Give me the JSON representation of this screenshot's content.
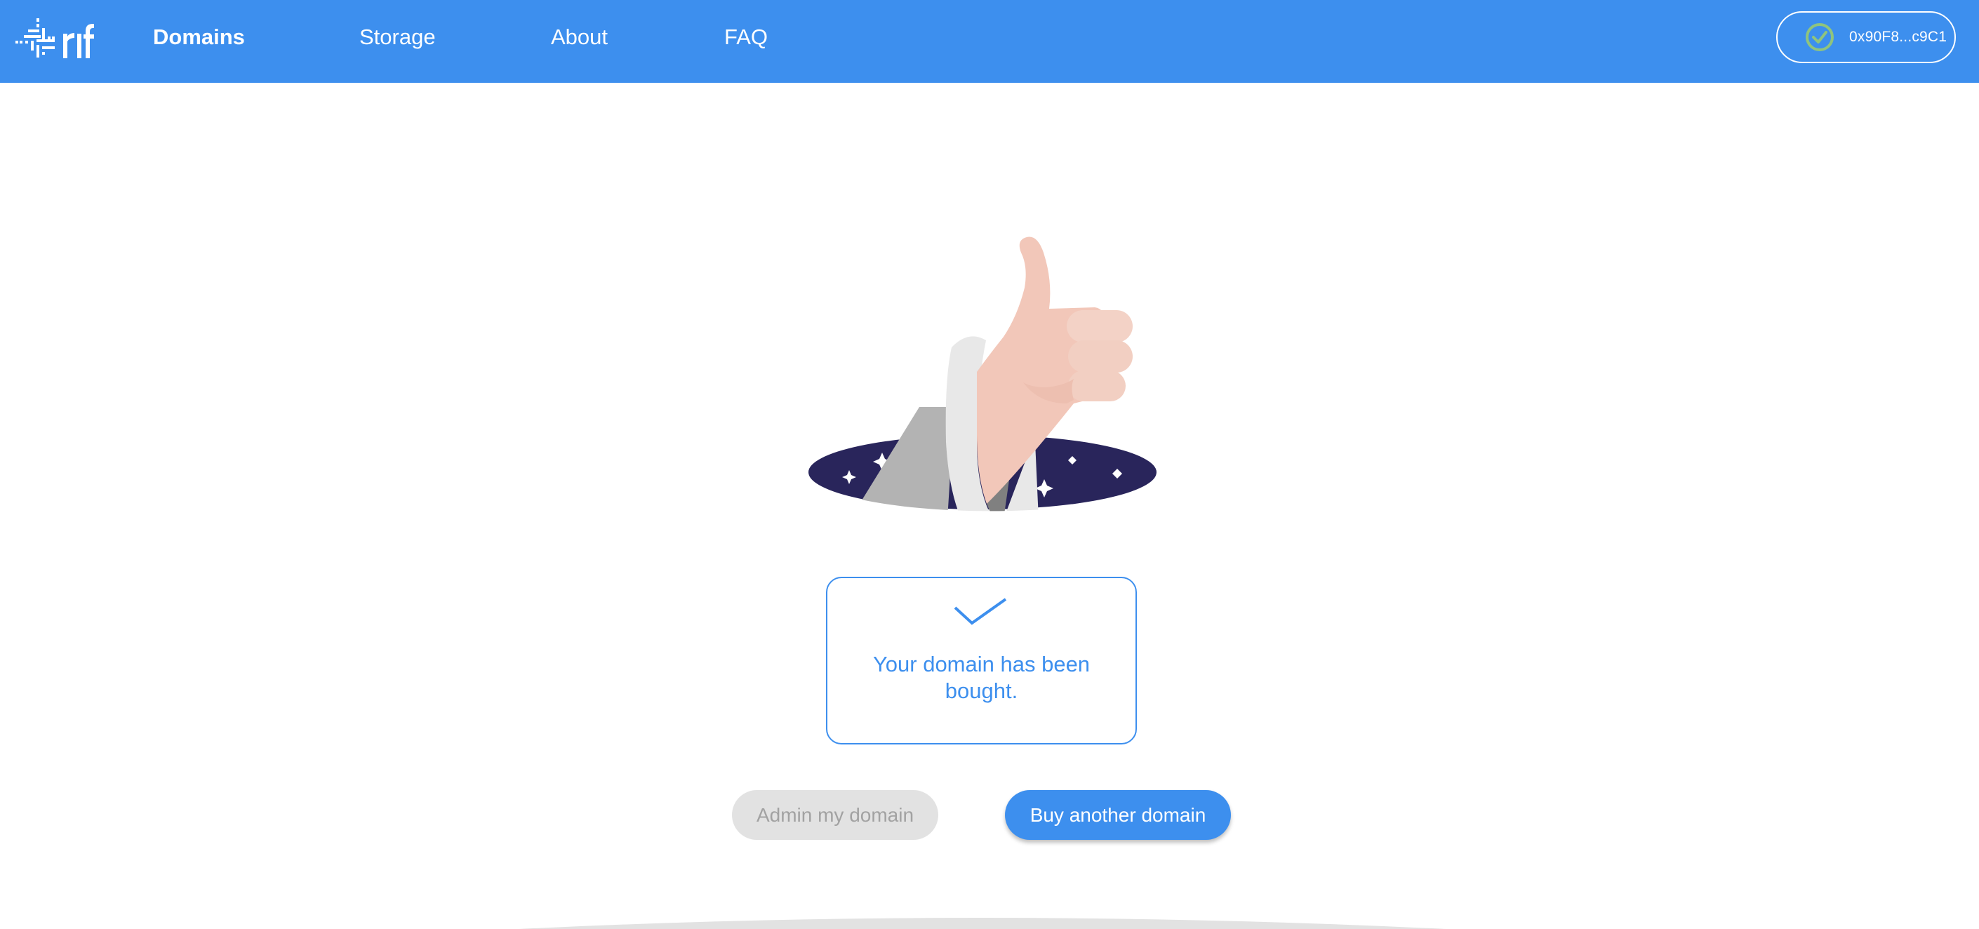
{
  "header": {
    "logo_text": "rif",
    "nav": [
      {
        "label": "Domains",
        "active": true
      },
      {
        "label": "Storage",
        "active": false
      },
      {
        "label": "About",
        "active": false
      },
      {
        "label": "FAQ",
        "active": false
      }
    ],
    "wallet": {
      "address": "0x90F8...c9C1",
      "status_icon": "check-circle-icon",
      "status_color": "#8fc47e"
    }
  },
  "main": {
    "illustration": "thumbs-up-hand-from-hole",
    "success_card": {
      "icon": "checkmark-icon",
      "message": "Your domain has been bought."
    },
    "buttons": {
      "admin_label": "Admin my domain",
      "buy_label": "Buy another domain"
    }
  },
  "colors": {
    "brand_blue": "#3d8fee",
    "hole_navy": "#29255b",
    "skin": "#f2c7b9",
    "disabled_bg": "#e2e2e2",
    "disabled_text": "#a2a2a2"
  }
}
